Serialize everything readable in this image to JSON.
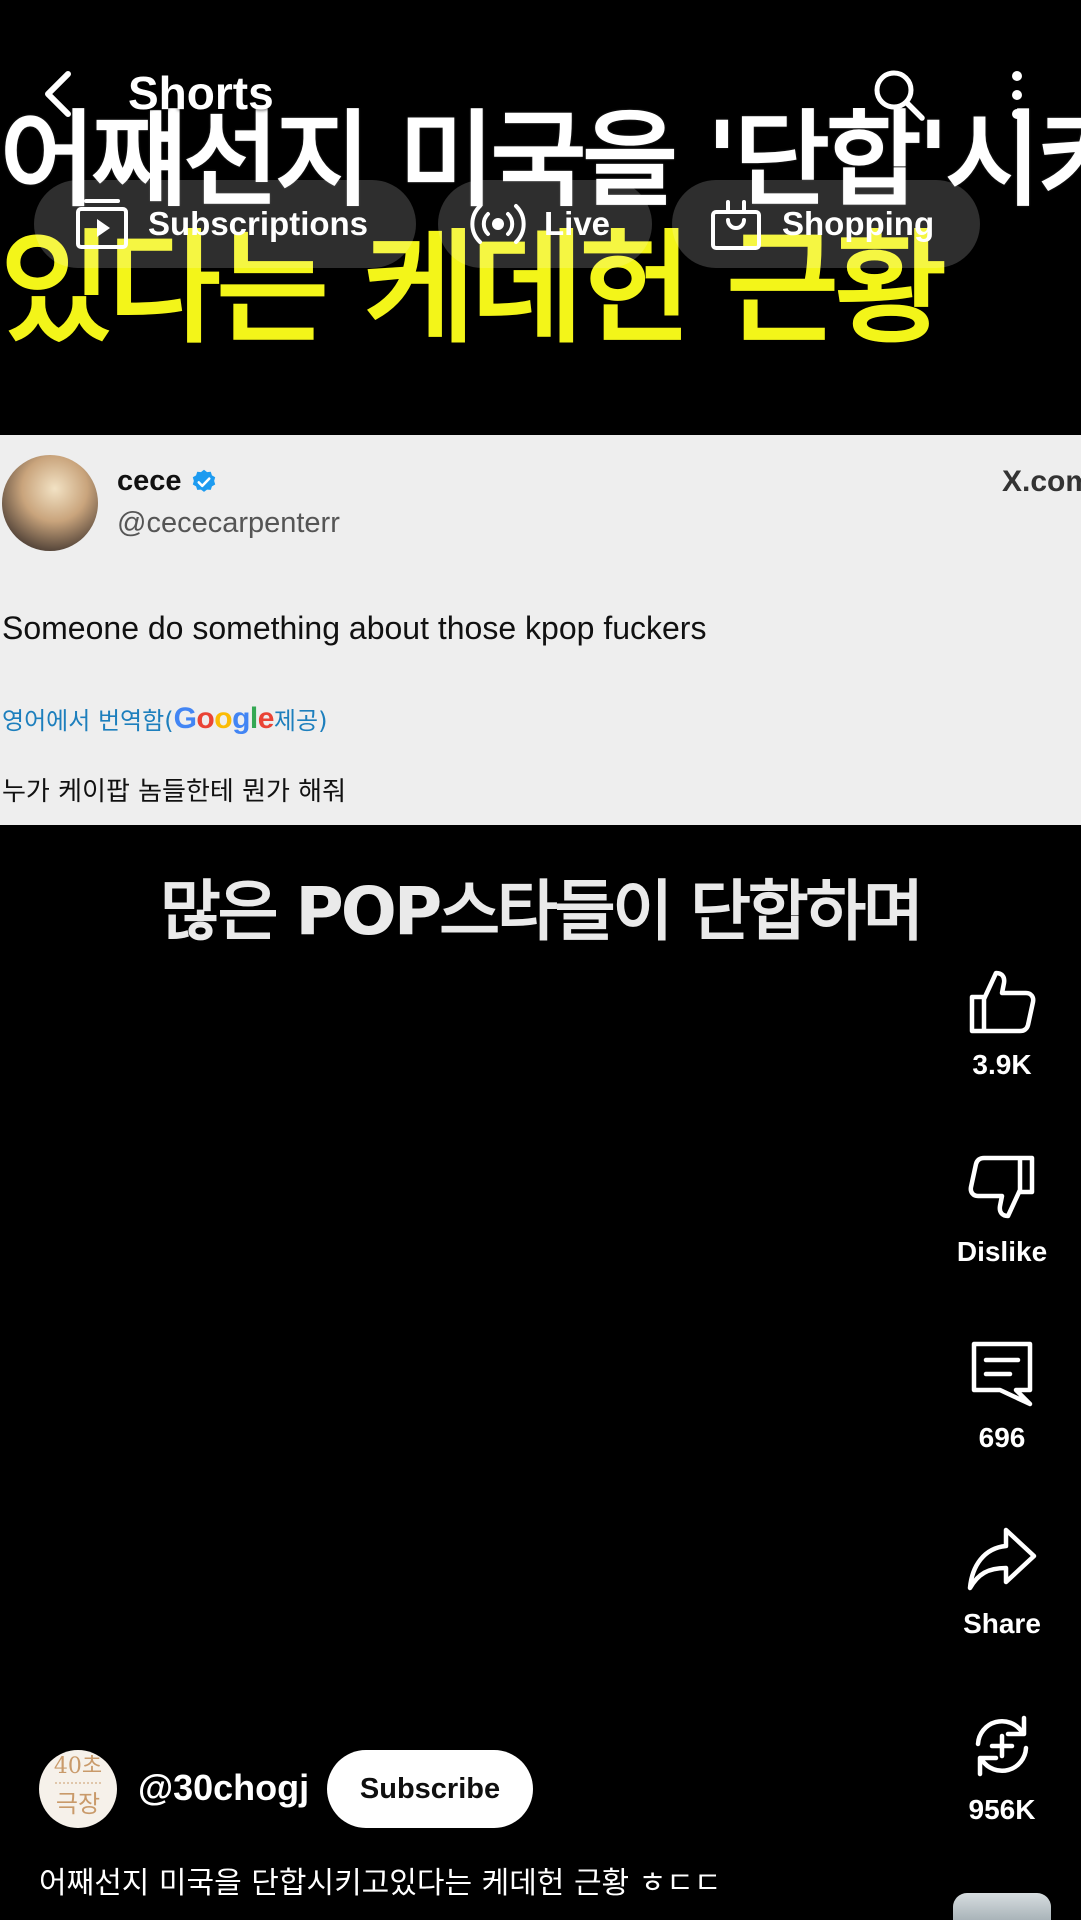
{
  "top_bar": {
    "title": "Shorts"
  },
  "chips": [
    {
      "label": "Subscriptions",
      "icon": "subscriptions-icon"
    },
    {
      "label": "Live",
      "icon": "live-broadcast-icon"
    },
    {
      "label": "Shopping",
      "icon": "shopping-bag-icon"
    }
  ],
  "video": {
    "headline_line1": "어쨰선지 미국을 '단합'시키고",
    "headline_line2": "있다는 케데헌 근황",
    "headline_line1_color": "#ffffff",
    "headline_line2_color": "#f3f519",
    "tweet": {
      "name": "cece",
      "handle": "@cececarpenterr",
      "site": "X.com",
      "text": "Someone do something about those kpop fuckers",
      "translated_from_prefix": "영어에서 번역함(",
      "translated_from_brand": "Google",
      "translated_from_suffix": " 제공)",
      "translated_text": "누가 케이팝 놈들한테 뭔가 해줘"
    },
    "subtitle": "많은 POP스타들이 단합하며"
  },
  "actions": {
    "like_count": "3.9K",
    "dislike_label": "Dislike",
    "comment_count": "696",
    "share_label": "Share",
    "remix_count": "956K"
  },
  "channel": {
    "avatar_text_top": "40초",
    "avatar_text_bottom": "극장",
    "handle": "@30chogj",
    "subscribe_label": "Subscribe"
  },
  "video_title": "어째선지 미국을 단합시키고있다는 케데헌 근황 ㅎㄷㄷ",
  "colors": {
    "background": "#000000",
    "chip_background": "rgba(255,255,255,0.18)",
    "subscribe_button": "#ffffff"
  }
}
